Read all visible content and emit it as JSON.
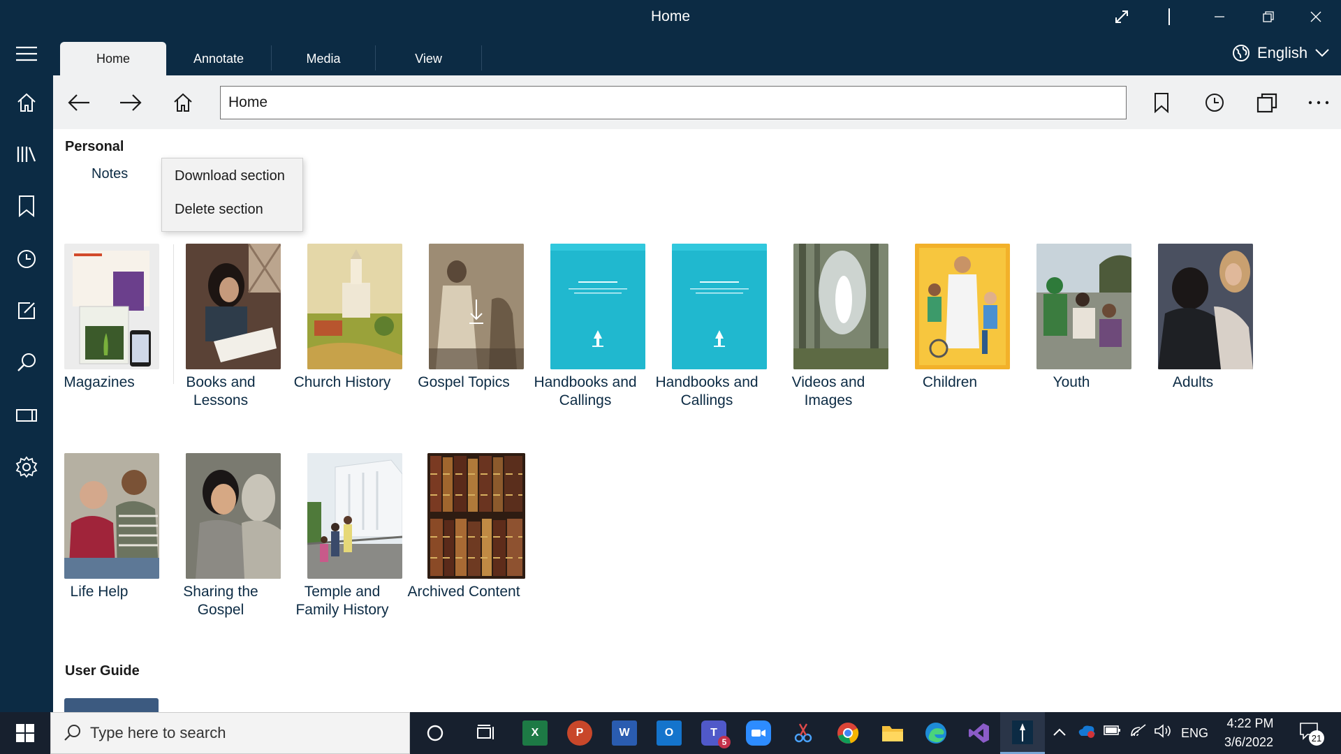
{
  "window": {
    "title": "Home"
  },
  "tabs": [
    "Home",
    "Annotate",
    "Media",
    "View"
  ],
  "language": "English",
  "nav": {
    "address_value": "Home"
  },
  "personal": {
    "title": "Personal",
    "notes": "Notes"
  },
  "context_menu": {
    "items": [
      "Download section",
      "Delete section"
    ]
  },
  "library_tiles": [
    {
      "label": "Magazines"
    },
    {
      "label": "Books and Lessons"
    },
    {
      "label": "Church History"
    },
    {
      "label": "Gospel Topics"
    },
    {
      "label": "Handbooks and Callings"
    },
    {
      "label": "Handbooks and Callings"
    },
    {
      "label": "Videos and Images"
    },
    {
      "label": "Children"
    },
    {
      "label": "Youth"
    },
    {
      "label": "Adults"
    },
    {
      "label": "Life Help"
    },
    {
      "label": "Sharing the Gospel"
    },
    {
      "label": "Temple and Family History"
    },
    {
      "label": "Archived Content"
    }
  ],
  "user_guide": {
    "title": "User Guide"
  },
  "taskbar": {
    "search_placeholder": "Type here to search",
    "language": "ENG",
    "time": "4:22 PM",
    "date": "3/6/2022",
    "notifications": "21",
    "teams_badge": "5"
  },
  "colors": {
    "brand_navy": "#0c2b44",
    "handbook_teal": "#20b8cf",
    "children_yellow": "#f2b12a"
  }
}
